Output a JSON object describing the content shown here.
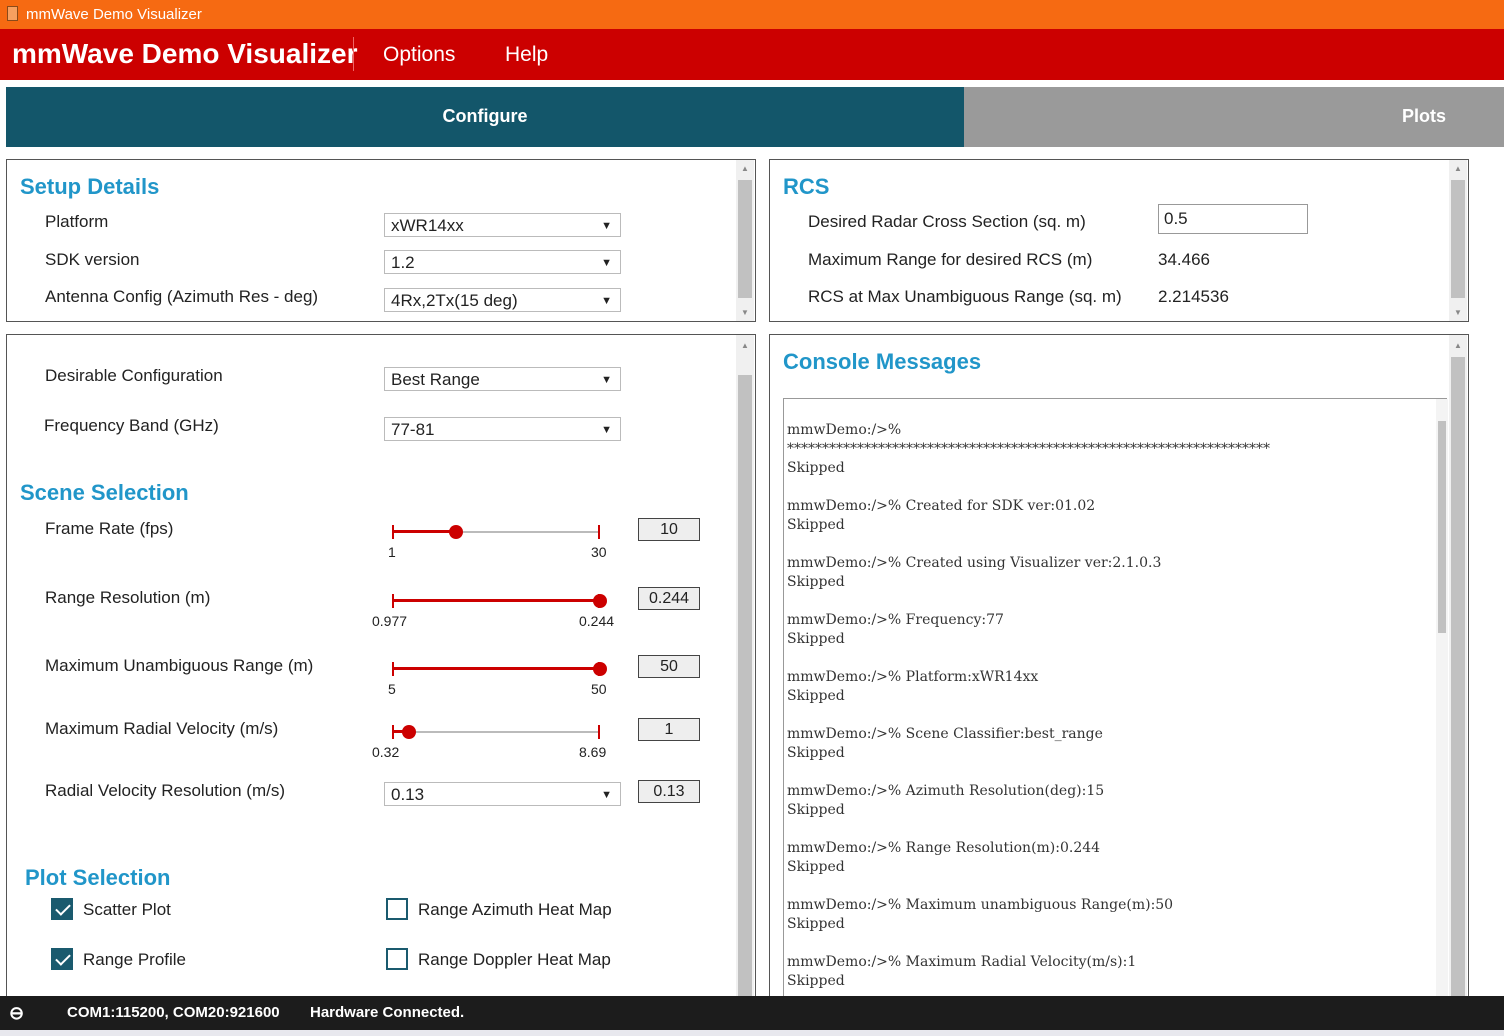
{
  "window_title": "mmWave Demo Visualizer",
  "header": {
    "brand": "mmWave Demo Visualizer",
    "menu": [
      "Options",
      "Help"
    ]
  },
  "tabs": [
    {
      "label": "Configure",
      "active": true
    },
    {
      "label": "Plots",
      "active": false
    }
  ],
  "setup": {
    "title": "Setup Details",
    "rows": [
      {
        "label": "Platform",
        "value": "xWR14xx"
      },
      {
        "label": "SDK version",
        "value": "1.2"
      },
      {
        "label": "Antenna Config (Azimuth Res - deg)",
        "value": "4Rx,2Tx(15 deg)"
      }
    ]
  },
  "rcs": {
    "title": "RCS",
    "desired_label": "Desired Radar Cross Section (sq. m)",
    "desired_value": "0.5",
    "max_range_label": "Maximum Range for desired RCS (m)",
    "max_range_value": "34.466",
    "rcs_max_label": "RCS at Max Unambiguous Range (sq. m)",
    "rcs_max_value": "2.214536"
  },
  "config": {
    "desirable_label": "Desirable Configuration",
    "desirable_value": "Best Range",
    "band_label": "Frequency Band (GHz)",
    "band_value": "77-81"
  },
  "scene": {
    "title": "Scene Selection",
    "sliders": [
      {
        "label": "Frame Rate (fps)",
        "min": "1",
        "max": "30",
        "value": "10",
        "fraction": 0.31
      },
      {
        "label": "Range Resolution (m)",
        "min": "0.977",
        "max": "0.244",
        "value": "0.244",
        "fraction": 1.0
      },
      {
        "label": "Maximum Unambiguous Range (m)",
        "min": "5",
        "max": "50",
        "value": "50",
        "fraction": 1.0
      },
      {
        "label": "Maximum Radial Velocity (m/s)",
        "min": "0.32",
        "max": "8.69",
        "value": "1",
        "fraction": 0.08
      }
    ],
    "vel_res_label": "Radial Velocity Resolution (m/s)",
    "vel_res_select": "0.13",
    "vel_res_value": "0.13"
  },
  "plots": {
    "title": "Plot Selection",
    "items": [
      {
        "label": "Scatter Plot",
        "checked": true
      },
      {
        "label": "Range Azimuth Heat Map",
        "checked": false
      },
      {
        "label": "Range Profile",
        "checked": true
      },
      {
        "label": "Range Doppler Heat Map",
        "checked": false
      }
    ]
  },
  "console": {
    "title": "Console Messages",
    "messages": [
      "mmwDemo:/>%\n*********************************************************************\nSkipped",
      "mmwDemo:/>% Created for SDK ver:01.02\nSkipped",
      "mmwDemo:/>% Created using Visualizer ver:2.1.0.3\nSkipped",
      "mmwDemo:/>% Frequency:77\nSkipped",
      "mmwDemo:/>% Platform:xWR14xx\nSkipped",
      "mmwDemo:/>% Scene Classifier:best_range\nSkipped",
      "mmwDemo:/>% Azimuth Resolution(deg):15\nSkipped",
      "mmwDemo:/>% Range Resolution(m):0.244\nSkipped",
      "mmwDemo:/>% Maximum unambiguous Range(m):50\nSkipped",
      "mmwDemo:/>% Maximum Radial Velocity(m/s):1\nSkipped"
    ]
  },
  "status": {
    "ports": "COM1:115200, COM20:921600",
    "state": "Hardware Connected."
  }
}
